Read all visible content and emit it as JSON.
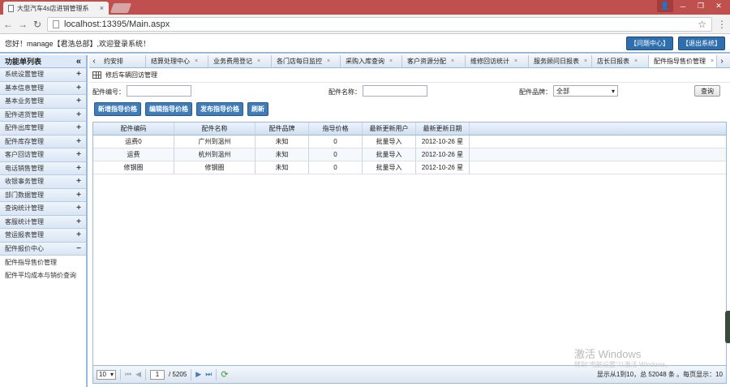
{
  "browser": {
    "tab_title": "大型汽车4s店进销管理系",
    "tab_close": "×",
    "url": "localhost:13395/Main.aspx"
  },
  "header": {
    "welcome": "您好！manage【君浩总部】,欢迎登录系统！",
    "btn_help": "【问题中心】",
    "btn_logout": "【退出系统】"
  },
  "sidebar": {
    "title": "功能单列表",
    "collapse": "«",
    "items": [
      {
        "label": "系统设置管理",
        "sign": "+"
      },
      {
        "label": "基本信息管理",
        "sign": "+"
      },
      {
        "label": "基本业务管理",
        "sign": "+"
      },
      {
        "label": "配件进货管理",
        "sign": "+"
      },
      {
        "label": "配件出库管理",
        "sign": "+"
      },
      {
        "label": "配件库存管理",
        "sign": "+"
      },
      {
        "label": "客户回访管理",
        "sign": "+"
      },
      {
        "label": "电话销售管理",
        "sign": "+"
      },
      {
        "label": "收银事务管理",
        "sign": "+"
      },
      {
        "label": "部门数据管理",
        "sign": "+"
      },
      {
        "label": "查询统计管理",
        "sign": "+"
      },
      {
        "label": "客服统计管理",
        "sign": "+"
      },
      {
        "label": "营运报表管理",
        "sign": "+"
      },
      {
        "label": "配件报价中心",
        "sign": "−"
      }
    ],
    "subitems": [
      "配件指导售价管理",
      "配件平均成本与销价查询"
    ]
  },
  "tabs": {
    "left_arrow": "‹",
    "right_arrow": "›",
    "close": "×",
    "list": [
      "约安排",
      "结算处理中心",
      "业务费用登记",
      "各门店每日监控",
      "采购入库查询",
      "客户资源分配",
      "维修回访统计",
      "服务顾问日报表",
      "店长日报表",
      "配件指导售价管理"
    ]
  },
  "breadcrumb": "修后车辆回访管理",
  "search": {
    "part_no_label": "配件编号：",
    "part_name_label": "配件名称：",
    "brand_label": "配件品牌：",
    "brand_value": "全部",
    "query_btn": "查询"
  },
  "toolbar": {
    "new": "新增指导价格",
    "edit": "编辑指导价格",
    "publish": "发布指导价格",
    "refresh": "刷新"
  },
  "table": {
    "columns": [
      "配件编码",
      "配件名称",
      "配件品牌",
      "指导价格",
      "最新更新用户",
      "最新更新日期"
    ],
    "rows": [
      [
        "运费0",
        "广州到温州",
        "未知",
        "0",
        "批量导入",
        "2012-10-26 星"
      ],
      [
        "运费",
        "杭州到温州",
        "未知",
        "0",
        "批量导入",
        "2012-10-26 星"
      ],
      [
        "修钢圈",
        "修钢圈",
        "未知",
        "0",
        "批量导入",
        "2012-10-26 星"
      ]
    ]
  },
  "pager": {
    "page_size": "10",
    "current_page": "1",
    "total_pages": "/ 5205",
    "info": "显示从1到10，总 52048 条 。每页显示：10"
  },
  "watermark": {
    "line1": "激活 Windows",
    "line2": "转到\"电脑设置\"以激活 Windows。"
  }
}
